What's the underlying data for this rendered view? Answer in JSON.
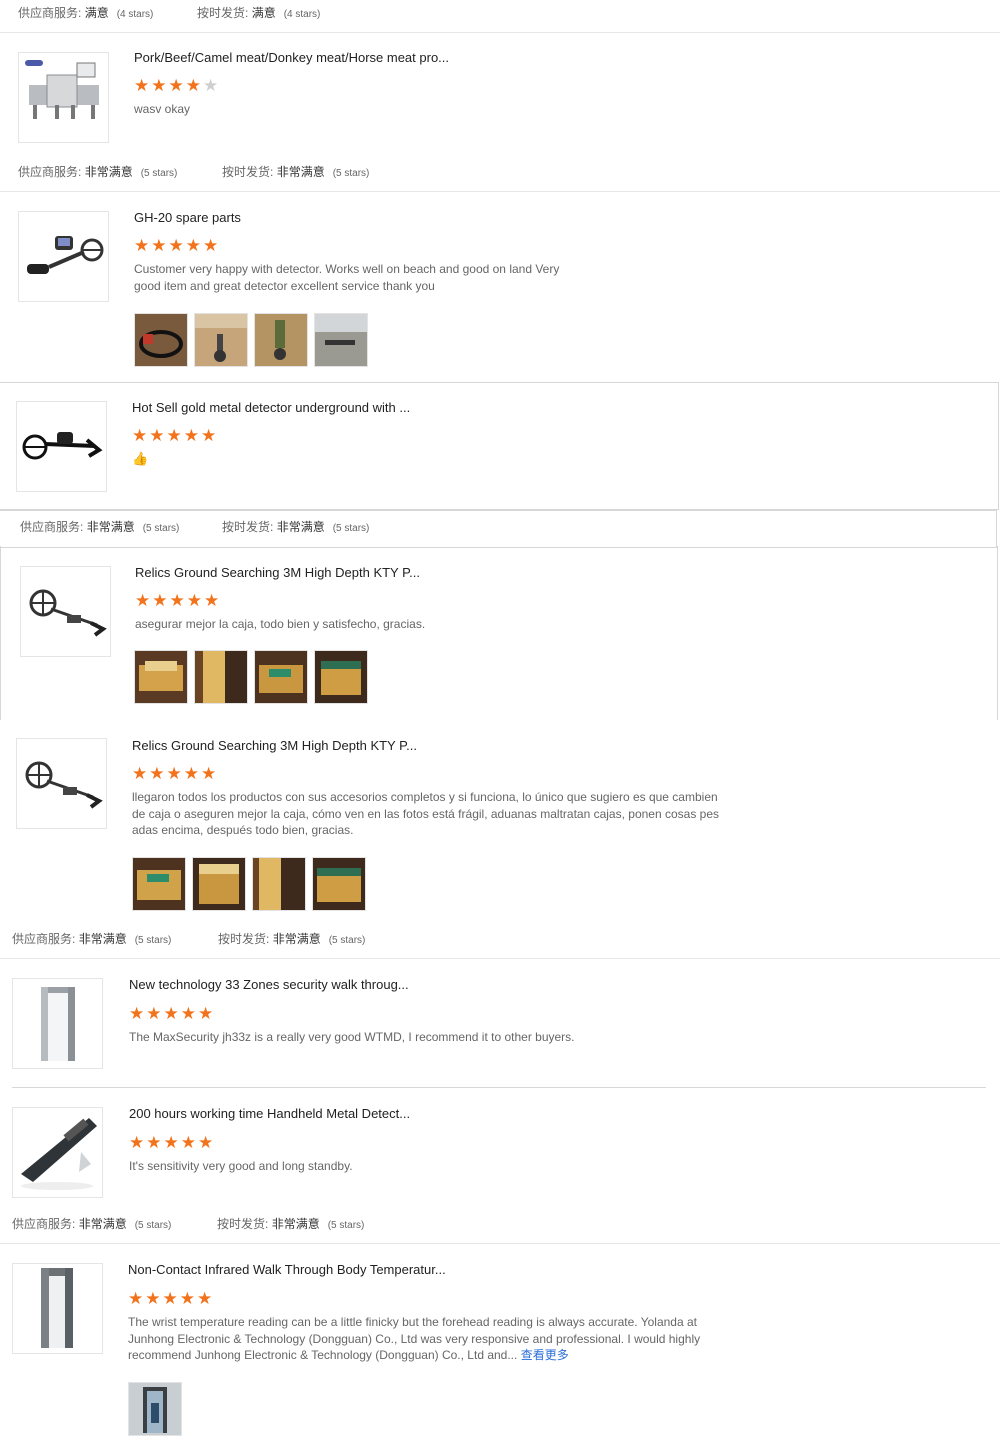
{
  "labels": {
    "service": "供应商服务:",
    "shipping": "按时发货:"
  },
  "meta_rows": [
    {
      "service_value": "满意",
      "service_stars": "(4 stars)",
      "shipping_value": "满意",
      "shipping_stars": "(4 stars)"
    },
    {
      "service_value": "非常满意",
      "service_stars": "(5 stars)",
      "shipping_value": "非常满意",
      "shipping_stars": "(5 stars)"
    },
    {
      "service_value": "非常满意",
      "service_stars": "(5 stars)",
      "shipping_value": "非常满意",
      "shipping_stars": "(5 stars)"
    },
    {
      "service_value": "非常满意",
      "service_stars": "(5 stars)",
      "shipping_value": "非常满意",
      "shipping_stars": "(5 stars)"
    },
    {
      "service_value": "非常满意",
      "service_stars": "(5 stars)",
      "shipping_value": "非常满意",
      "shipping_stars": "(5 stars)"
    }
  ],
  "reviews": [
    {
      "product": "Pork/Beef/Camel meat/Donkey meat/Horse meat pro...",
      "rating": 4,
      "text": "wasv okay",
      "product_image": "food-metal-detector-machine"
    },
    {
      "product": "GH-20 spare parts",
      "rating": 5,
      "text": "Customer very happy with detector. Works well on beach and good on land Very good item and great detector excellent service thank you",
      "product_image": "handheld-metal-detector"
    },
    {
      "product": "Hot Sell gold metal detector underground with ...",
      "rating": 5,
      "text": "👍",
      "product_image": "gold-metal-detector"
    },
    {
      "product": "Relics Ground Searching 3M High Depth KTY P...",
      "rating": 5,
      "text": "asegurar mejor la caja, todo bien y satisfecho, gracias.",
      "product_image": "ground-search-detector"
    },
    {
      "product": "Relics Ground Searching 3M High Depth KTY P...",
      "rating": 5,
      "text": "llegaron todos los productos con sus accesorios completos y si funciona, lo único que sugiero es que cambien de caja  o aseguren mejor la caja, cómo ven en las fotos está frágil, aduanas maltratan cajas, ponen cosas pesadas encima, después todo bien, gracias.",
      "product_image": "ground-search-detector"
    },
    {
      "product": "New technology 33 Zones security walk throug...",
      "rating": 5,
      "text": "The MaxSecurity jh33z is a really very good WTMD, I recommend it to other buyers.",
      "product_image": "walk-through-gate"
    },
    {
      "product": "200 hours working time Handheld Metal Detect...",
      "rating": 5,
      "text": "It's sensitivity very good and long standby.",
      "product_image": "handheld-wand"
    },
    {
      "product": "Non-Contact Infrared Walk Through Body Temperatur...",
      "rating": 5,
      "text": "The wrist temperature reading can be a little finicky but the forehead reading is always accurate. Yolanda at Junhong Electronic & Technology (Dongguan) Co., Ltd was very responsive and professional. I would highly recommend Junhong Electronic & Technology (Dongguan) Co., Ltd and...",
      "more_link": "查看更多",
      "product_image": "temperature-gate"
    }
  ],
  "colors": {
    "star": "#f2731c",
    "star_off": "#cfcfcf",
    "link": "#2a6ed8",
    "divider": "#e6e6e6"
  },
  "icons": {
    "star": "star-icon",
    "thumbs_up": "thumbs-up-icon"
  }
}
